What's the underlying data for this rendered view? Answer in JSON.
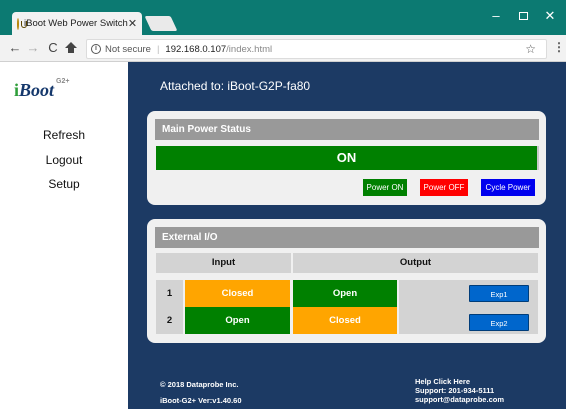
{
  "browser": {
    "tab_title": "iBoot Web Power Switch",
    "tab_close": "✕",
    "window_minimize": "–",
    "window_close": "✕",
    "nav_back": "←",
    "nav_forward": "→",
    "nav_reload": "C",
    "security_label": "Not secure",
    "url_separator": "|",
    "url_host": "192.168.0.107",
    "url_path": "/index.html",
    "bookmark_star": "☆",
    "menu": "⋮"
  },
  "sidebar": {
    "logo": {
      "i": "i",
      "boot": "Boot",
      "superscript": "G2+"
    },
    "items": [
      {
        "label": "Refresh"
      },
      {
        "label": "Logout"
      },
      {
        "label": "Setup"
      }
    ]
  },
  "main": {
    "attached_text": "Attached to: iBoot-G2P-fa80",
    "power": {
      "header": "Main Power Status",
      "status": "ON",
      "buttons": {
        "on": "Power ON",
        "off": "Power OFF",
        "cycle": "Cycle Power"
      }
    },
    "io": {
      "header": "External I/O",
      "col_input": "Input",
      "col_output": "Output",
      "rows": [
        {
          "num": "1",
          "input": "Closed",
          "output": "Open",
          "button": "Exp1"
        },
        {
          "num": "2",
          "input": "Open",
          "output": "Closed",
          "button": "Exp2"
        }
      ]
    }
  },
  "footer": {
    "copyright": "© 2018 Dataprobe Inc.",
    "version": "iBoot-G2+ Ver:v1.40.60",
    "help": "Help Click Here",
    "phone": "Support: 201-934-5111",
    "email": "support@dataprobe.com"
  },
  "colors": {
    "page_bg": "#1c3a64",
    "titlebar": "#0c7a72",
    "status_on": "#008000",
    "closed": "#ffa500",
    "open": "#008000",
    "power_off": "#ff0000",
    "cycle": "#0000ee",
    "exp_button": "#0066cc"
  }
}
